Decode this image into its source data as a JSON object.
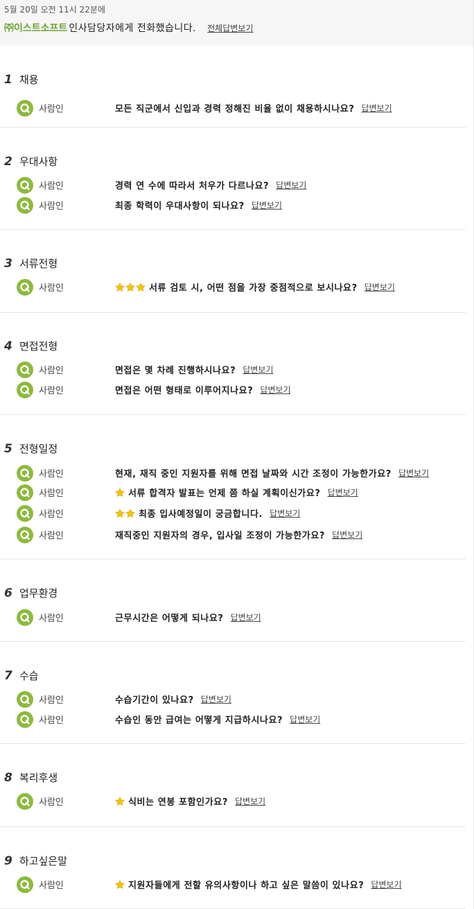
{
  "header": {
    "date": "5월 20일 오전 11시 22분에",
    "company": "㈜이스트소프트",
    "message": "인사담당자에게 전화했습니다.",
    "view_all": "전체답변보기"
  },
  "answer_link": "답변보기",
  "colors": {
    "accent_green": "#6aa535",
    "icon_green": "#8cba3c",
    "star_yellow": "#f5c400"
  },
  "sections": [
    {
      "num": "1",
      "title": "채용",
      "questions": [
        {
          "asker": "사람인",
          "stars": 0,
          "text": "모든 직군에서 신입과 경력 정해진 비율 없이 채용하시나요?"
        }
      ]
    },
    {
      "num": "2",
      "title": "우대사항",
      "questions": [
        {
          "asker": "사람인",
          "stars": 0,
          "text": "경력 연 수에 따라서 처우가 다르나요?"
        },
        {
          "asker": "사람인",
          "stars": 0,
          "text": "최종 학력이 우대사항이 되나요?"
        }
      ]
    },
    {
      "num": "3",
      "title": "서류전형",
      "questions": [
        {
          "asker": "사람인",
          "stars": 3,
          "text": "서류 검토 시, 어떤 점을 가장 중점적으로 보시나요?"
        }
      ]
    },
    {
      "num": "4",
      "title": "면접전형",
      "questions": [
        {
          "asker": "사람인",
          "stars": 0,
          "text": "면접은 몇 차례 진행하시나요?"
        },
        {
          "asker": "사람인",
          "stars": 0,
          "text": "면접은 어떤 형태로 이루어지나요?"
        }
      ]
    },
    {
      "num": "5",
      "title": "전형일정",
      "questions": [
        {
          "asker": "사람인",
          "stars": 0,
          "text": "현재, 재직 중인 지원자를 위해 면접 날짜와 시간 조정이 가능한가요?"
        },
        {
          "asker": "사람인",
          "stars": 1,
          "text": "서류 합격자 발표는 언제 쯤 하실 계획이신가요?"
        },
        {
          "asker": "사람인",
          "stars": 2,
          "text": "최종 입사예정일이 궁금합니다."
        },
        {
          "asker": "사람인",
          "stars": 0,
          "text": "재직중인 지원자의 경우, 입사일 조정이 가능한가요?"
        }
      ]
    },
    {
      "num": "6",
      "title": "업무환경",
      "questions": [
        {
          "asker": "사람인",
          "stars": 0,
          "text": "근무시간은 어떻게 되나요?"
        }
      ]
    },
    {
      "num": "7",
      "title": "수습",
      "questions": [
        {
          "asker": "사람인",
          "stars": 0,
          "text": "수습기간이 있나요?"
        },
        {
          "asker": "사람인",
          "stars": 0,
          "text": "수습인 동안 급여는 어떻게 지급하시나요?"
        }
      ]
    },
    {
      "num": "8",
      "title": "복리후생",
      "questions": [
        {
          "asker": "사람인",
          "stars": 1,
          "text": "식비는 연봉 포함인가요?"
        }
      ]
    },
    {
      "num": "9",
      "title": "하고싶은말",
      "questions": [
        {
          "asker": "사람인",
          "stars": 1,
          "text": "지원자들에게 전할 유의사항이나 하고 싶은 말씀이 있나요?"
        }
      ]
    }
  ]
}
